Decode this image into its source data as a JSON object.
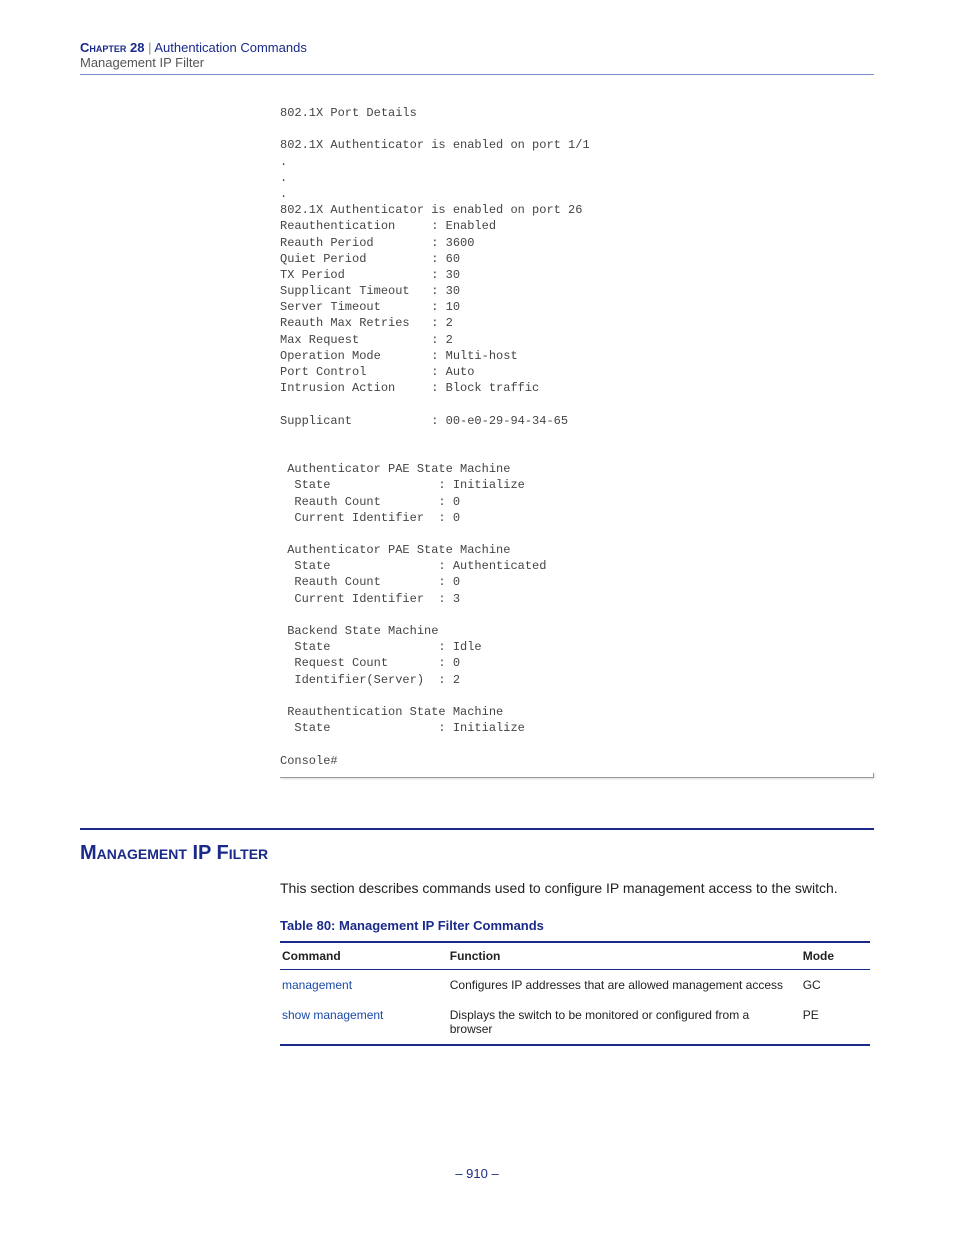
{
  "header": {
    "chapter_label": "Chapter 28",
    "separator": "  |  ",
    "chapter_title": "Authentication Commands",
    "sub": "Management IP Filter"
  },
  "code_listing": "802.1X Port Details\n\n802.1X Authenticator is enabled on port 1/1\n.\n.\n.\n802.1X Authenticator is enabled on port 26\nReauthentication     : Enabled\nReauth Period        : 3600\nQuiet Period         : 60\nTX Period            : 30\nSupplicant Timeout   : 30\nServer Timeout       : 10\nReauth Max Retries   : 2\nMax Request          : 2\nOperation Mode       : Multi-host\nPort Control         : Auto\nIntrusion Action     : Block traffic\n\nSupplicant           : 00-e0-29-94-34-65\n\n\n Authenticator PAE State Machine\n  State               : Initialize\n  Reauth Count        : 0\n  Current Identifier  : 0\n\n Authenticator PAE State Machine\n  State               : Authenticated\n  Reauth Count        : 0\n  Current Identifier  : 3\n\n Backend State Machine\n  State               : Idle\n  Request Count       : 0\n  Identifier(Server)  : 2\n\n Reauthentication State Machine\n  State               : Initialize\n\nConsole#",
  "section": {
    "heading": "Management IP Filter",
    "body": "This section describes commands used to configure IP management access to the switch."
  },
  "table": {
    "caption": "Table 80: Management IP Filter Commands",
    "headers": {
      "col1": "Command",
      "col2": "Function",
      "col3": "Mode"
    },
    "rows": [
      {
        "cmd": "management",
        "func": "Configures IP addresses that are allowed management access",
        "mode": "GC"
      },
      {
        "cmd": "show management",
        "func": "Displays the switch to be monitored or configured from a browser",
        "mode": "PE"
      }
    ]
  },
  "footer": "–  910  –"
}
